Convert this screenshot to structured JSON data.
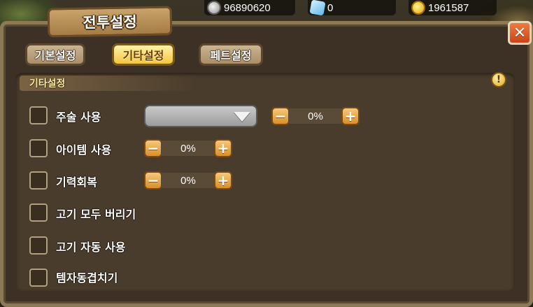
{
  "currency": {
    "silver": "96890620",
    "gem": "0",
    "gold": "1961587"
  },
  "panel": {
    "title": "전투설정",
    "close_label": "✕"
  },
  "tabs": [
    {
      "label": "기본설정",
      "active": false
    },
    {
      "label": "기타설정",
      "active": true
    },
    {
      "label": "페트설정",
      "active": false
    }
  ],
  "section": {
    "title": "기타설정",
    "info_label": "!"
  },
  "rows": [
    {
      "label": "주술 사용",
      "checked": false,
      "dropdown_value": "",
      "value": "0%"
    },
    {
      "label": "아이템 사용",
      "checked": false,
      "value": "0%"
    },
    {
      "label": "기력회복",
      "checked": false,
      "value": "0%"
    },
    {
      "label": "고기 모두 버리기",
      "checked": false
    },
    {
      "label": "고기 자동 사용",
      "checked": false
    },
    {
      "label": "템자동겹치기",
      "checked": false
    }
  ],
  "stepper": {
    "minus_label": "−",
    "plus_label": "+"
  },
  "colors": {
    "active_tab": "#f4c640",
    "inactive_tab": "#a98e69",
    "section_title": "#f6e6a0",
    "close_button": "#c9461a"
  }
}
